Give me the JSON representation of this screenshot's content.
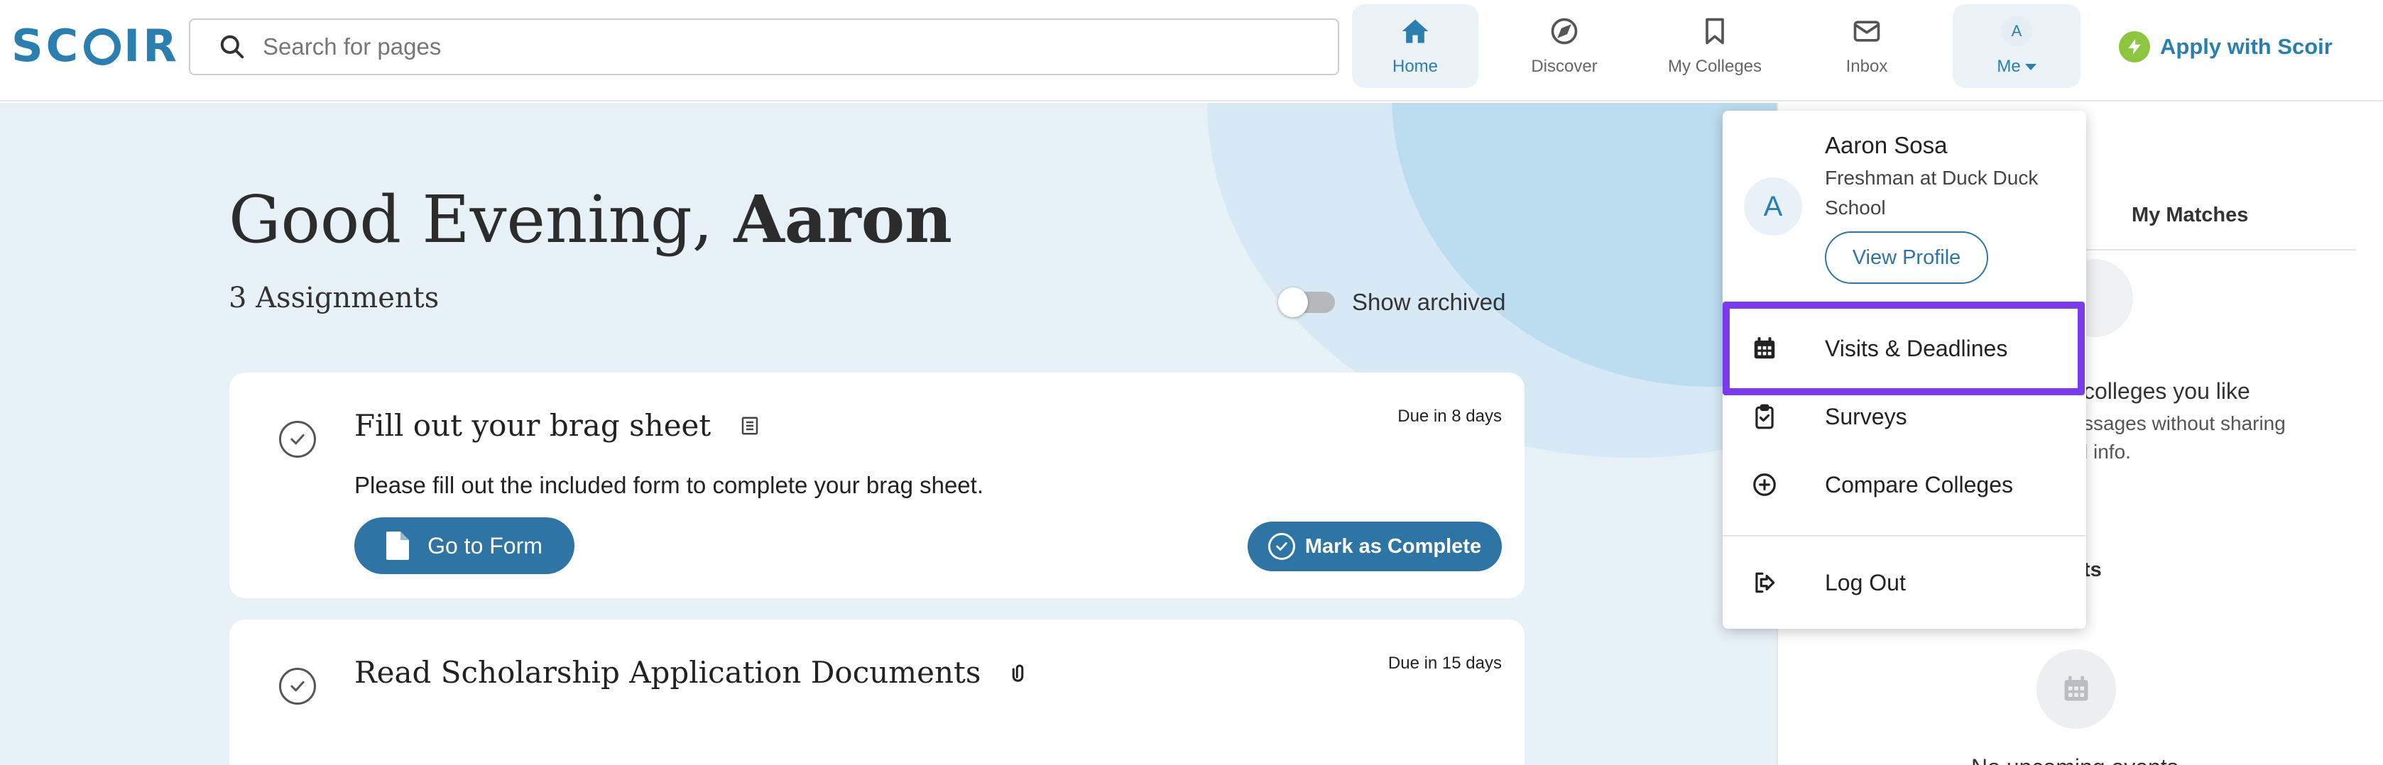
{
  "header": {
    "logo_text": "SCOIR",
    "search_placeholder": "Search for pages",
    "nav": [
      {
        "label": "Home",
        "icon": "home-icon",
        "active": true
      },
      {
        "label": "Discover",
        "icon": "compass-icon",
        "active": false
      },
      {
        "label": "My Colleges",
        "icon": "bookmark-icon",
        "active": false
      },
      {
        "label": "Inbox",
        "icon": "mail-icon",
        "active": false
      }
    ],
    "me": {
      "avatar_letter": "A",
      "label": "Me"
    },
    "apply_label": "Apply with Scoir",
    "accent_color": "#2a7fb0",
    "bolt_color": "#8cc63f"
  },
  "main": {
    "greeting_prefix": "Good Evening,",
    "greeting_name": "Aaron",
    "assignment_count": "3 Assignments",
    "show_archived_label": "Show archived",
    "show_archived_on": false,
    "assignments": [
      {
        "title": "Fill out your brag sheet",
        "due": "Due in 8 days",
        "description": "Please fill out the included form to complete your brag sheet.",
        "primary_action": "Go to Form",
        "complete_action": "Mark as Complete",
        "type_icon": "form-icon"
      },
      {
        "title": "Read Scholarship Application Documents",
        "due": "Due in 15 days",
        "type_icon": "paperclip-icon"
      }
    ]
  },
  "right_panel": {
    "tab": "My Matches",
    "text_line1": "colleges you like",
    "text_line2": "ssages without sharing",
    "text_line3": "l info.",
    "section_fragment": "ts",
    "bottom_fragment": "No upcoming events"
  },
  "menu": {
    "avatar_letter": "A",
    "name": "Aaron Sosa",
    "subtitle": "Freshman at Duck Duck School",
    "view_profile": "View Profile",
    "items": [
      {
        "label": "Visits & Deadlines",
        "icon": "calendar-icon",
        "highlighted": true
      },
      {
        "label": "Surveys",
        "icon": "clipboard-icon"
      },
      {
        "label": "Compare Colleges",
        "icon": "plus-circle-icon"
      }
    ],
    "logout": {
      "label": "Log Out",
      "icon": "logout-icon"
    },
    "highlight_color": "#7c3aed"
  }
}
